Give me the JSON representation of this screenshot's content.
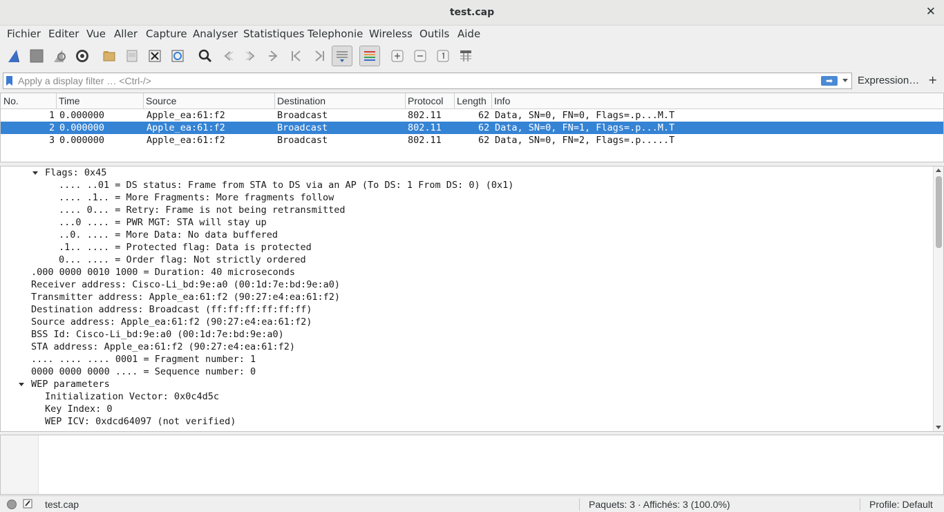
{
  "window": {
    "title": "test.cap",
    "close_icon": "close-icon"
  },
  "menu": [
    "Fichier",
    "Editer",
    "Vue",
    "Aller",
    "Capture",
    "Analyser",
    "Statistiques",
    "Telephonie",
    "Wireless",
    "Outils",
    "Aide"
  ],
  "toolbar": {
    "icons": [
      "shark-fin-start-icon",
      "stop-icon",
      "restart-icon",
      "options-gear-icon",
      "open-folder-icon",
      "save-icon",
      "close-file-icon",
      "reload-icon",
      "search-icon",
      "go-back-icon",
      "go-forward-icon",
      "go-to-packet-icon",
      "first-packet-icon",
      "last-packet-icon",
      "autoscroll-icon",
      "colorize-icon",
      "zoom-in-icon",
      "zoom-out-icon",
      "normal-size-icon",
      "resize-columns-icon"
    ]
  },
  "filter": {
    "placeholder": "Apply a display filter … <Ctrl-/>",
    "expression_label": "Expression…",
    "add_label": "+"
  },
  "packet_list": {
    "columns": [
      "No.",
      "Time",
      "Source",
      "Destination",
      "Protocol",
      "Length",
      "Info"
    ],
    "rows": [
      {
        "no": "1",
        "time": "0.000000",
        "source": "Apple_ea:61:f2",
        "destination": "Broadcast",
        "protocol": "802.11",
        "length": "62",
        "info": "Data, SN=0, FN=0, Flags=.p...M.T"
      },
      {
        "no": "2",
        "time": "0.000000",
        "source": "Apple_ea:61:f2",
        "destination": "Broadcast",
        "protocol": "802.11",
        "length": "62",
        "info": "Data, SN=0, FN=1, Flags=.p...M.T"
      },
      {
        "no": "3",
        "time": "0.000000",
        "source": "Apple_ea:61:f2",
        "destination": "Broadcast",
        "protocol": "802.11",
        "length": "62",
        "info": "Data, SN=0, FN=2, Flags=.p.....T"
      }
    ],
    "selected_row": 2
  },
  "details": {
    "lines": [
      "Flags: 0x45",
      ".... ..01 = DS status: Frame from STA to DS via an AP (To DS: 1 From DS: 0) (0x1)",
      ".... .1.. = More Fragments: More fragments follow",
      ".... 0... = Retry: Frame is not being retransmitted",
      "...0 .... = PWR MGT: STA will stay up",
      "..0. .... = More Data: No data buffered",
      ".1.. .... = Protected flag: Data is protected",
      "0... .... = Order flag: Not strictly ordered",
      ".000 0000 0010 1000 = Duration: 40 microseconds",
      "Receiver address: Cisco-Li_bd:9e:a0 (00:1d:7e:bd:9e:a0)",
      "Transmitter address: Apple_ea:61:f2 (90:27:e4:ea:61:f2)",
      "Destination address: Broadcast (ff:ff:ff:ff:ff:ff)",
      "Source address: Apple_ea:61:f2 (90:27:e4:ea:61:f2)",
      "BSS Id: Cisco-Li_bd:9e:a0 (00:1d:7e:bd:9e:a0)",
      "STA address: Apple_ea:61:f2 (90:27:e4:ea:61:f2)",
      ".... .... .... 0001 = Fragment number: 1",
      "0000 0000 0000 .... = Sequence number: 0",
      "WEP parameters",
      "Initialization Vector: 0x0c4d5c",
      "Key Index: 0",
      "WEP ICV: 0xdcd64097 (not verified)"
    ]
  },
  "status": {
    "file": "test.cap",
    "packets": "Paquets: 3 · Affichés: 3 (100.0%)",
    "profile": "Profile: Default"
  }
}
